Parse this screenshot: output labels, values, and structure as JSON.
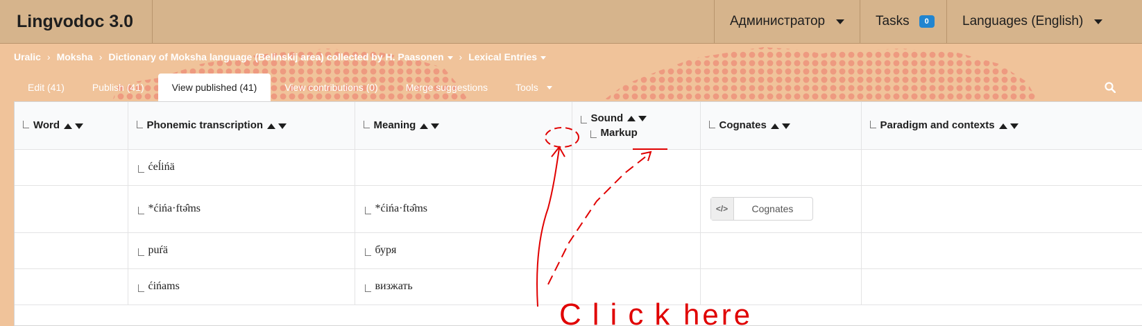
{
  "app": {
    "title": "Lingvodoc 3.0"
  },
  "header": {
    "user_menu": "Администратор",
    "tasks_label": "Tasks",
    "tasks_count": "0",
    "languages_menu": "Languages (English)"
  },
  "breadcrumb": {
    "items": [
      "Uralic",
      "Moksha",
      "Dictionary of Moksha language (Belinskij area) collected by H. Paasonen",
      "Lexical Entries"
    ]
  },
  "tabs": [
    "Edit (41)",
    "Publish (41)",
    "View published (41)",
    "View contributions (0)",
    "Merge suggestions",
    "Tools"
  ],
  "table": {
    "columns": [
      "Word",
      "Phonemic transcription",
      "Meaning",
      "Sound",
      "Markup",
      "Cognates",
      "Paradigm and contexts"
    ],
    "rows": [
      {
        "word": "",
        "transcription": "ćeĺińä",
        "meaning": "",
        "cognates": ""
      },
      {
        "word": "",
        "transcription": "*ćińa·ftə̂ms",
        "meaning": "*ćińa·ftə̂ms",
        "cognates": "Cognates"
      },
      {
        "word": "",
        "transcription": "puŕä",
        "meaning": "буря",
        "cognates": ""
      },
      {
        "word": "",
        "transcription": "ćińams",
        "meaning": "визжать",
        "cognates": ""
      }
    ]
  },
  "annotation": {
    "text_click": "Click",
    "text_here": "here",
    "color": "#e00000"
  },
  "colors": {
    "topbar": "#d6b48c",
    "background": "#f0c39a",
    "dots": "#ee9a80",
    "badge": "#2185d0"
  },
  "icons": [
    "caret-down-icon",
    "search-icon",
    "code-icon",
    "tree-branch-icon",
    "sort-up-icon",
    "sort-down-icon"
  ]
}
